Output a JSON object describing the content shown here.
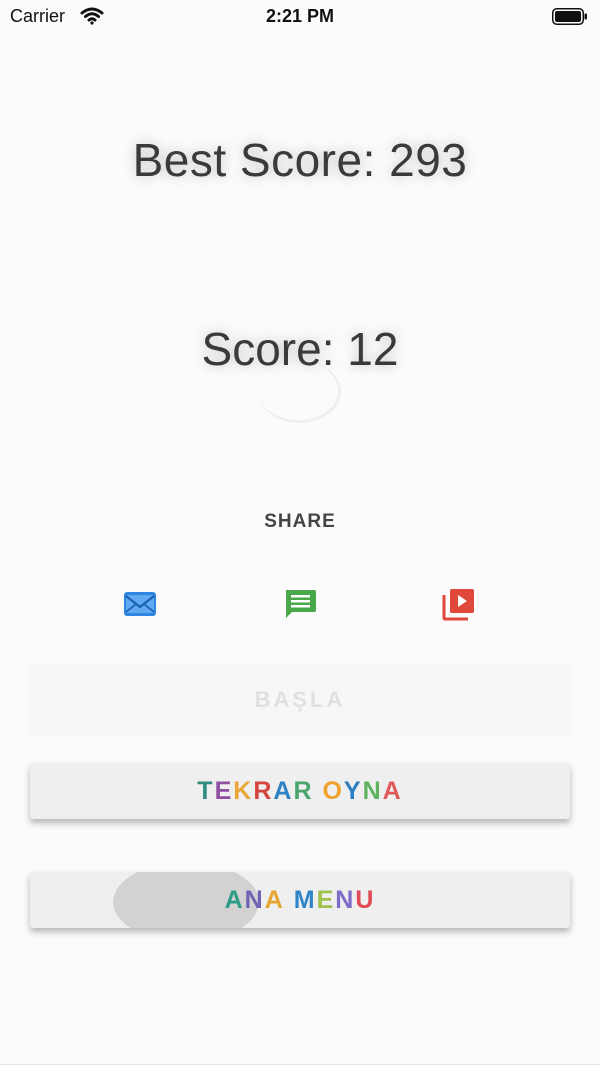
{
  "status_bar": {
    "carrier": "Carrier",
    "time": "2:21 PM"
  },
  "scores": {
    "best_score": "Best Score: 293",
    "score": "Score: 12"
  },
  "share": {
    "label": "SHARE",
    "icons": [
      {
        "name": "mail-icon",
        "color": "#2f86e0"
      },
      {
        "name": "message-icon",
        "color": "#49a84a"
      },
      {
        "name": "video-share-icon",
        "color": "#e0483b"
      }
    ]
  },
  "ghost_button": {
    "label": "BAŞLA"
  },
  "buttons": {
    "replay_letters": [
      "T",
      "E",
      "K",
      "R",
      "A",
      "R",
      " ",
      "O",
      "Y",
      "N",
      "A"
    ],
    "replay_colors": [
      "#2e8d7e",
      "#8f4ea0",
      "#e9a63a",
      "#d6453d",
      "#2f83c4",
      "#4aa56e",
      "#333333",
      "#f0a22d",
      "#2c7fc1",
      "#5fb25f",
      "#e05a5a"
    ],
    "menu_letters": [
      "A",
      "N",
      "A",
      " ",
      "M",
      "E",
      "N",
      "U"
    ],
    "menu_colors": [
      "#2e9c86",
      "#6d63b3",
      "#e7a631",
      "#333333",
      "#2e84c6",
      "#9fc24c",
      "#7e6cc8",
      "#e04c55"
    ]
  }
}
